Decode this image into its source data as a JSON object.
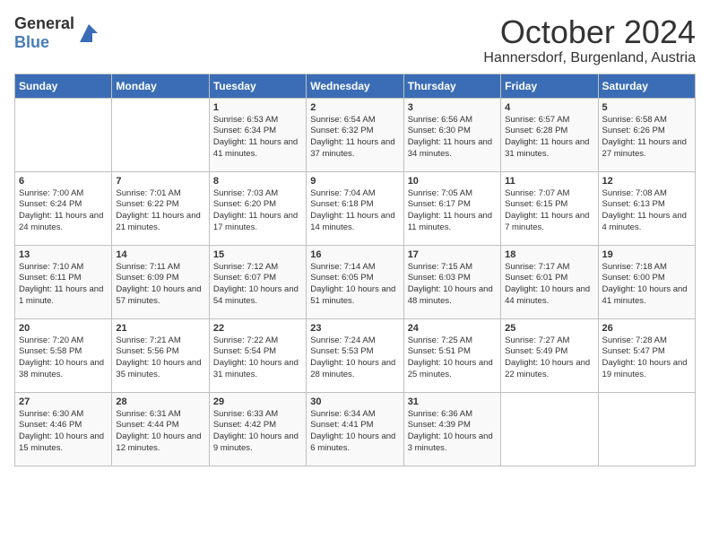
{
  "logo": {
    "general": "General",
    "blue": "Blue"
  },
  "title": {
    "month": "October 2024",
    "location": "Hannersdorf, Burgenland, Austria"
  },
  "weekdays": [
    "Sunday",
    "Monday",
    "Tuesday",
    "Wednesday",
    "Thursday",
    "Friday",
    "Saturday"
  ],
  "weeks": [
    [
      {
        "day": "",
        "sunrise": "",
        "sunset": "",
        "daylight": ""
      },
      {
        "day": "",
        "sunrise": "",
        "sunset": "",
        "daylight": ""
      },
      {
        "day": "1",
        "sunrise": "Sunrise: 6:53 AM",
        "sunset": "Sunset: 6:34 PM",
        "daylight": "Daylight: 11 hours and 41 minutes."
      },
      {
        "day": "2",
        "sunrise": "Sunrise: 6:54 AM",
        "sunset": "Sunset: 6:32 PM",
        "daylight": "Daylight: 11 hours and 37 minutes."
      },
      {
        "day": "3",
        "sunrise": "Sunrise: 6:56 AM",
        "sunset": "Sunset: 6:30 PM",
        "daylight": "Daylight: 11 hours and 34 minutes."
      },
      {
        "day": "4",
        "sunrise": "Sunrise: 6:57 AM",
        "sunset": "Sunset: 6:28 PM",
        "daylight": "Daylight: 11 hours and 31 minutes."
      },
      {
        "day": "5",
        "sunrise": "Sunrise: 6:58 AM",
        "sunset": "Sunset: 6:26 PM",
        "daylight": "Daylight: 11 hours and 27 minutes."
      }
    ],
    [
      {
        "day": "6",
        "sunrise": "Sunrise: 7:00 AM",
        "sunset": "Sunset: 6:24 PM",
        "daylight": "Daylight: 11 hours and 24 minutes."
      },
      {
        "day": "7",
        "sunrise": "Sunrise: 7:01 AM",
        "sunset": "Sunset: 6:22 PM",
        "daylight": "Daylight: 11 hours and 21 minutes."
      },
      {
        "day": "8",
        "sunrise": "Sunrise: 7:03 AM",
        "sunset": "Sunset: 6:20 PM",
        "daylight": "Daylight: 11 hours and 17 minutes."
      },
      {
        "day": "9",
        "sunrise": "Sunrise: 7:04 AM",
        "sunset": "Sunset: 6:18 PM",
        "daylight": "Daylight: 11 hours and 14 minutes."
      },
      {
        "day": "10",
        "sunrise": "Sunrise: 7:05 AM",
        "sunset": "Sunset: 6:17 PM",
        "daylight": "Daylight: 11 hours and 11 minutes."
      },
      {
        "day": "11",
        "sunrise": "Sunrise: 7:07 AM",
        "sunset": "Sunset: 6:15 PM",
        "daylight": "Daylight: 11 hours and 7 minutes."
      },
      {
        "day": "12",
        "sunrise": "Sunrise: 7:08 AM",
        "sunset": "Sunset: 6:13 PM",
        "daylight": "Daylight: 11 hours and 4 minutes."
      }
    ],
    [
      {
        "day": "13",
        "sunrise": "Sunrise: 7:10 AM",
        "sunset": "Sunset: 6:11 PM",
        "daylight": "Daylight: 11 hours and 1 minute."
      },
      {
        "day": "14",
        "sunrise": "Sunrise: 7:11 AM",
        "sunset": "Sunset: 6:09 PM",
        "daylight": "Daylight: 10 hours and 57 minutes."
      },
      {
        "day": "15",
        "sunrise": "Sunrise: 7:12 AM",
        "sunset": "Sunset: 6:07 PM",
        "daylight": "Daylight: 10 hours and 54 minutes."
      },
      {
        "day": "16",
        "sunrise": "Sunrise: 7:14 AM",
        "sunset": "Sunset: 6:05 PM",
        "daylight": "Daylight: 10 hours and 51 minutes."
      },
      {
        "day": "17",
        "sunrise": "Sunrise: 7:15 AM",
        "sunset": "Sunset: 6:03 PM",
        "daylight": "Daylight: 10 hours and 48 minutes."
      },
      {
        "day": "18",
        "sunrise": "Sunrise: 7:17 AM",
        "sunset": "Sunset: 6:01 PM",
        "daylight": "Daylight: 10 hours and 44 minutes."
      },
      {
        "day": "19",
        "sunrise": "Sunrise: 7:18 AM",
        "sunset": "Sunset: 6:00 PM",
        "daylight": "Daylight: 10 hours and 41 minutes."
      }
    ],
    [
      {
        "day": "20",
        "sunrise": "Sunrise: 7:20 AM",
        "sunset": "Sunset: 5:58 PM",
        "daylight": "Daylight: 10 hours and 38 minutes."
      },
      {
        "day": "21",
        "sunrise": "Sunrise: 7:21 AM",
        "sunset": "Sunset: 5:56 PM",
        "daylight": "Daylight: 10 hours and 35 minutes."
      },
      {
        "day": "22",
        "sunrise": "Sunrise: 7:22 AM",
        "sunset": "Sunset: 5:54 PM",
        "daylight": "Daylight: 10 hours and 31 minutes."
      },
      {
        "day": "23",
        "sunrise": "Sunrise: 7:24 AM",
        "sunset": "Sunset: 5:53 PM",
        "daylight": "Daylight: 10 hours and 28 minutes."
      },
      {
        "day": "24",
        "sunrise": "Sunrise: 7:25 AM",
        "sunset": "Sunset: 5:51 PM",
        "daylight": "Daylight: 10 hours and 25 minutes."
      },
      {
        "day": "25",
        "sunrise": "Sunrise: 7:27 AM",
        "sunset": "Sunset: 5:49 PM",
        "daylight": "Daylight: 10 hours and 22 minutes."
      },
      {
        "day": "26",
        "sunrise": "Sunrise: 7:28 AM",
        "sunset": "Sunset: 5:47 PM",
        "daylight": "Daylight: 10 hours and 19 minutes."
      }
    ],
    [
      {
        "day": "27",
        "sunrise": "Sunrise: 6:30 AM",
        "sunset": "Sunset: 4:46 PM",
        "daylight": "Daylight: 10 hours and 15 minutes."
      },
      {
        "day": "28",
        "sunrise": "Sunrise: 6:31 AM",
        "sunset": "Sunset: 4:44 PM",
        "daylight": "Daylight: 10 hours and 12 minutes."
      },
      {
        "day": "29",
        "sunrise": "Sunrise: 6:33 AM",
        "sunset": "Sunset: 4:42 PM",
        "daylight": "Daylight: 10 hours and 9 minutes."
      },
      {
        "day": "30",
        "sunrise": "Sunrise: 6:34 AM",
        "sunset": "Sunset: 4:41 PM",
        "daylight": "Daylight: 10 hours and 6 minutes."
      },
      {
        "day": "31",
        "sunrise": "Sunrise: 6:36 AM",
        "sunset": "Sunset: 4:39 PM",
        "daylight": "Daylight: 10 hours and 3 minutes."
      },
      {
        "day": "",
        "sunrise": "",
        "sunset": "",
        "daylight": ""
      },
      {
        "day": "",
        "sunrise": "",
        "sunset": "",
        "daylight": ""
      }
    ]
  ]
}
